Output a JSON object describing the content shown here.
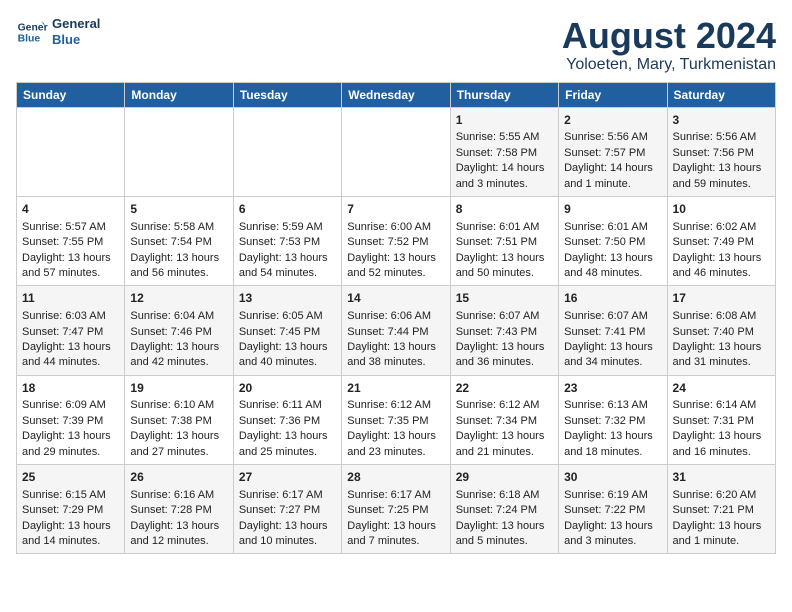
{
  "header": {
    "logo_line1": "General",
    "logo_line2": "Blue",
    "main_title": "August 2024",
    "subtitle": "Yoloeten, Mary, Turkmenistan"
  },
  "calendar": {
    "days_of_week": [
      "Sunday",
      "Monday",
      "Tuesday",
      "Wednesday",
      "Thursday",
      "Friday",
      "Saturday"
    ],
    "weeks": [
      [
        {
          "day": "",
          "text": ""
        },
        {
          "day": "",
          "text": ""
        },
        {
          "day": "",
          "text": ""
        },
        {
          "day": "",
          "text": ""
        },
        {
          "day": "1",
          "text": "Sunrise: 5:55 AM\nSunset: 7:58 PM\nDaylight: 14 hours\nand 3 minutes."
        },
        {
          "day": "2",
          "text": "Sunrise: 5:56 AM\nSunset: 7:57 PM\nDaylight: 14 hours\nand 1 minute."
        },
        {
          "day": "3",
          "text": "Sunrise: 5:56 AM\nSunset: 7:56 PM\nDaylight: 13 hours\nand 59 minutes."
        }
      ],
      [
        {
          "day": "4",
          "text": "Sunrise: 5:57 AM\nSunset: 7:55 PM\nDaylight: 13 hours\nand 57 minutes."
        },
        {
          "day": "5",
          "text": "Sunrise: 5:58 AM\nSunset: 7:54 PM\nDaylight: 13 hours\nand 56 minutes."
        },
        {
          "day": "6",
          "text": "Sunrise: 5:59 AM\nSunset: 7:53 PM\nDaylight: 13 hours\nand 54 minutes."
        },
        {
          "day": "7",
          "text": "Sunrise: 6:00 AM\nSunset: 7:52 PM\nDaylight: 13 hours\nand 52 minutes."
        },
        {
          "day": "8",
          "text": "Sunrise: 6:01 AM\nSunset: 7:51 PM\nDaylight: 13 hours\nand 50 minutes."
        },
        {
          "day": "9",
          "text": "Sunrise: 6:01 AM\nSunset: 7:50 PM\nDaylight: 13 hours\nand 48 minutes."
        },
        {
          "day": "10",
          "text": "Sunrise: 6:02 AM\nSunset: 7:49 PM\nDaylight: 13 hours\nand 46 minutes."
        }
      ],
      [
        {
          "day": "11",
          "text": "Sunrise: 6:03 AM\nSunset: 7:47 PM\nDaylight: 13 hours\nand 44 minutes."
        },
        {
          "day": "12",
          "text": "Sunrise: 6:04 AM\nSunset: 7:46 PM\nDaylight: 13 hours\nand 42 minutes."
        },
        {
          "day": "13",
          "text": "Sunrise: 6:05 AM\nSunset: 7:45 PM\nDaylight: 13 hours\nand 40 minutes."
        },
        {
          "day": "14",
          "text": "Sunrise: 6:06 AM\nSunset: 7:44 PM\nDaylight: 13 hours\nand 38 minutes."
        },
        {
          "day": "15",
          "text": "Sunrise: 6:07 AM\nSunset: 7:43 PM\nDaylight: 13 hours\nand 36 minutes."
        },
        {
          "day": "16",
          "text": "Sunrise: 6:07 AM\nSunset: 7:41 PM\nDaylight: 13 hours\nand 34 minutes."
        },
        {
          "day": "17",
          "text": "Sunrise: 6:08 AM\nSunset: 7:40 PM\nDaylight: 13 hours\nand 31 minutes."
        }
      ],
      [
        {
          "day": "18",
          "text": "Sunrise: 6:09 AM\nSunset: 7:39 PM\nDaylight: 13 hours\nand 29 minutes."
        },
        {
          "day": "19",
          "text": "Sunrise: 6:10 AM\nSunset: 7:38 PM\nDaylight: 13 hours\nand 27 minutes."
        },
        {
          "day": "20",
          "text": "Sunrise: 6:11 AM\nSunset: 7:36 PM\nDaylight: 13 hours\nand 25 minutes."
        },
        {
          "day": "21",
          "text": "Sunrise: 6:12 AM\nSunset: 7:35 PM\nDaylight: 13 hours\nand 23 minutes."
        },
        {
          "day": "22",
          "text": "Sunrise: 6:12 AM\nSunset: 7:34 PM\nDaylight: 13 hours\nand 21 minutes."
        },
        {
          "day": "23",
          "text": "Sunrise: 6:13 AM\nSunset: 7:32 PM\nDaylight: 13 hours\nand 18 minutes."
        },
        {
          "day": "24",
          "text": "Sunrise: 6:14 AM\nSunset: 7:31 PM\nDaylight: 13 hours\nand 16 minutes."
        }
      ],
      [
        {
          "day": "25",
          "text": "Sunrise: 6:15 AM\nSunset: 7:29 PM\nDaylight: 13 hours\nand 14 minutes."
        },
        {
          "day": "26",
          "text": "Sunrise: 6:16 AM\nSunset: 7:28 PM\nDaylight: 13 hours\nand 12 minutes."
        },
        {
          "day": "27",
          "text": "Sunrise: 6:17 AM\nSunset: 7:27 PM\nDaylight: 13 hours\nand 10 minutes."
        },
        {
          "day": "28",
          "text": "Sunrise: 6:17 AM\nSunset: 7:25 PM\nDaylight: 13 hours\nand 7 minutes."
        },
        {
          "day": "29",
          "text": "Sunrise: 6:18 AM\nSunset: 7:24 PM\nDaylight: 13 hours\nand 5 minutes."
        },
        {
          "day": "30",
          "text": "Sunrise: 6:19 AM\nSunset: 7:22 PM\nDaylight: 13 hours\nand 3 minutes."
        },
        {
          "day": "31",
          "text": "Sunrise: 6:20 AM\nSunset: 7:21 PM\nDaylight: 13 hours\nand 1 minute."
        }
      ]
    ]
  }
}
